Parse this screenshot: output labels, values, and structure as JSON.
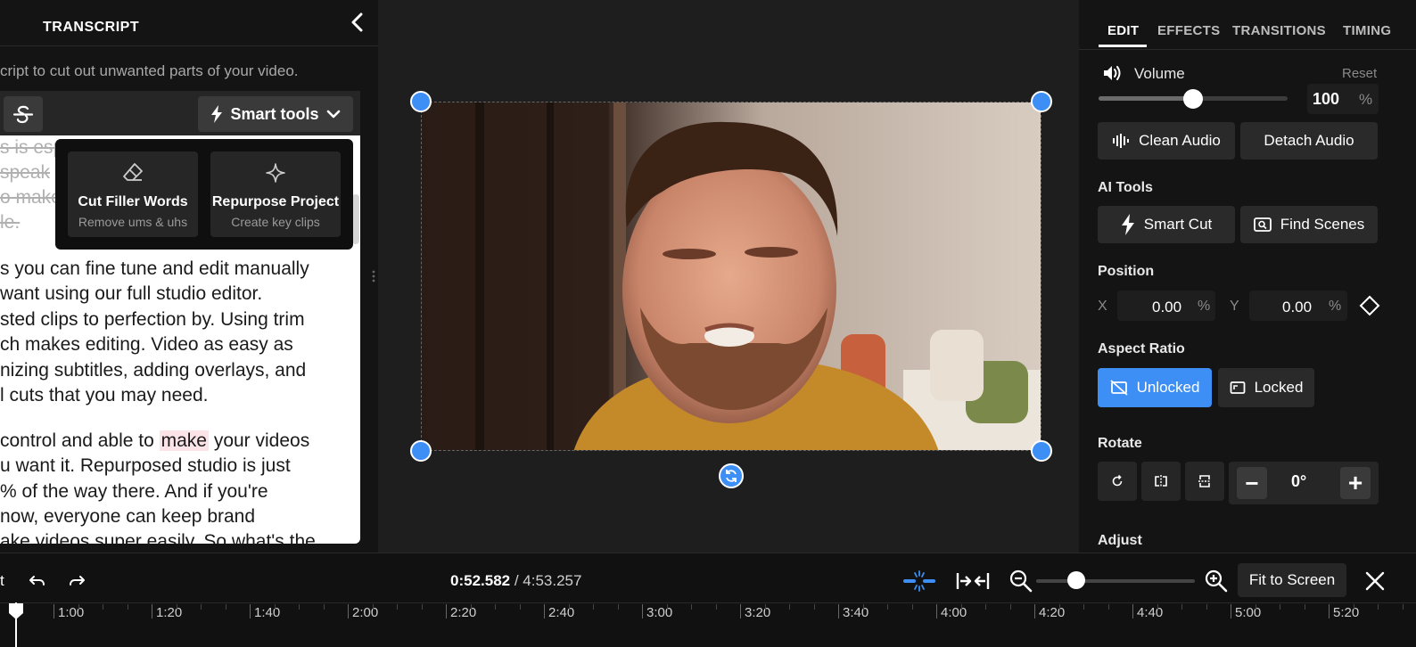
{
  "transcript": {
    "title": "TRANSCRIPT",
    "hint": "cript to cut out unwanted parts of your video.",
    "smart_tools_label": "Smart tools",
    "struck_lines": [
      "s is esp",
      " speak",
      "o make",
      "le."
    ],
    "paragraph1": [
      "s you can fine tune and edit manually",
      "want using our full studio editor.",
      "sted clips to perfection by. Using trim",
      "ch makes editing. Video as easy as",
      "nizing subtitles, adding overlays, and",
      "l cuts that you may need."
    ],
    "paragraph2_first": {
      "before": "control and able to ",
      "highlight": "make",
      "after": " your videos"
    },
    "paragraph2": [
      "u want it. Repurposed studio is just",
      "% of the way there. And if you're",
      "now, everyone can keep brand",
      "ake videos super easily. So what's the"
    ],
    "popover": {
      "cards": [
        {
          "title": "Cut Filler Words",
          "subtitle": "Remove ums & uhs"
        },
        {
          "title": "Repurpose Project",
          "subtitle": "Create key clips"
        }
      ]
    }
  },
  "tabs": [
    "EDIT",
    "EFFECTS",
    "TRANSITIONS",
    "TIMING"
  ],
  "active_tab": "EDIT",
  "volume": {
    "label": "Volume",
    "reset": "Reset",
    "value": "100",
    "unit": "%",
    "level": 0.5
  },
  "audio_buttons": {
    "clean": "Clean Audio",
    "detach": "Detach Audio"
  },
  "ai_tools": {
    "label": "AI Tools",
    "smart_cut": "Smart Cut",
    "find_scenes": "Find Scenes"
  },
  "position": {
    "label": "Position",
    "x_label": "X",
    "x_value": "0.00",
    "y_label": "Y",
    "y_value": "0.00",
    "unit": "%"
  },
  "aspect_ratio": {
    "label": "Aspect Ratio",
    "unlocked": "Unlocked",
    "locked": "Locked",
    "selected": "Unlocked"
  },
  "rotate": {
    "label": "Rotate",
    "value": "0°",
    "minus": "−",
    "plus": "+"
  },
  "adjust": {
    "label": "Adjust"
  },
  "timeline": {
    "left_fragment": "t",
    "current_time": "0:52.582",
    "total_time": " / 4:53.257",
    "fit_label": "Fit to Screen",
    "zoom_level": 0.25,
    "ticks": [
      "1:00",
      "1:20",
      "1:40",
      "2:00",
      "2:20",
      "2:40",
      "3:00",
      "3:20",
      "3:40",
      "4:00",
      "4:20",
      "4:40",
      "5:00",
      "5:20"
    ]
  },
  "colors": {
    "accent": "#3d8ef5",
    "highlight": "#fbe3e8"
  }
}
